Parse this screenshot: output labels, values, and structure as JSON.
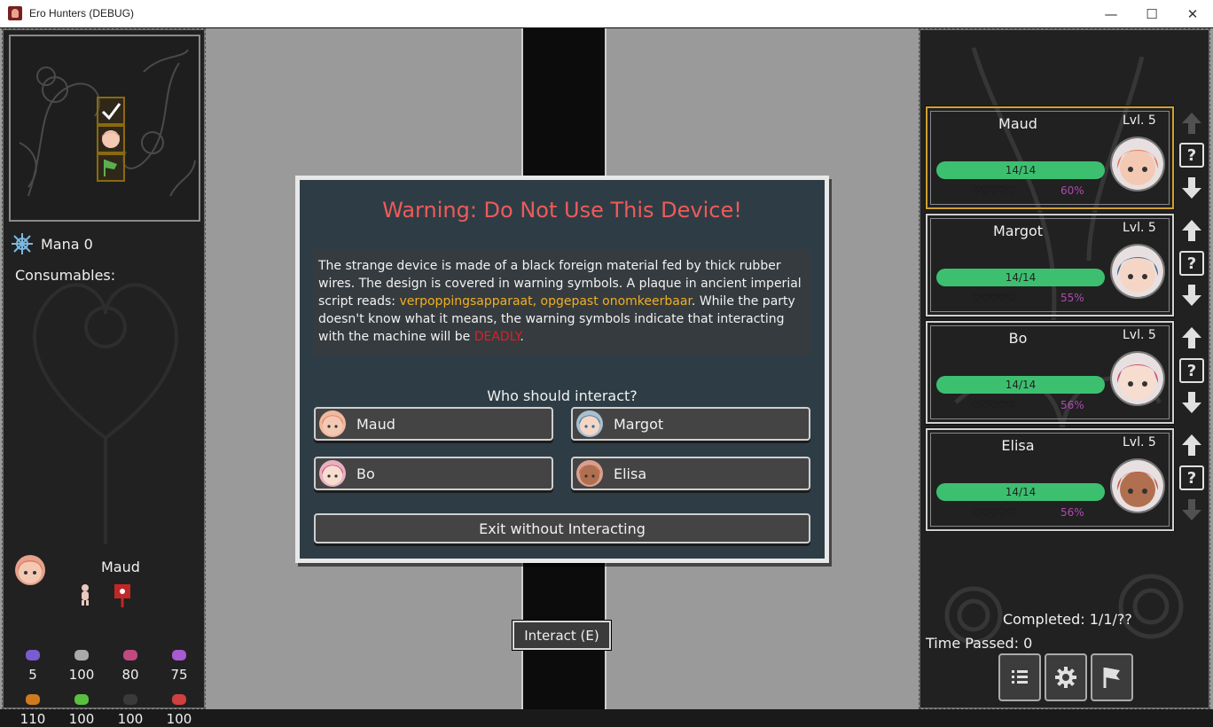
{
  "window": {
    "title": "Ero Hunters (DEBUG)",
    "minimize": "—",
    "maximize": "☐",
    "close": "✕"
  },
  "left": {
    "mana_label": "Mana 0",
    "consumables_label": "Consumables:",
    "character": {
      "name": "Maud",
      "stats": [
        {
          "icon": "level-bars-icon",
          "value": "5",
          "color": "#7a5bd0"
        },
        {
          "icon": "chain-icon",
          "value": "100",
          "color": "#aaaaaa"
        },
        {
          "icon": "pot-icon",
          "value": "80",
          "color": "#c04a80"
        },
        {
          "icon": "cloud-icon",
          "value": "75",
          "color": "#a85ad0"
        },
        {
          "icon": "strength-icon",
          "value": "110",
          "color": "#d07a20"
        },
        {
          "icon": "boot-icon",
          "value": "100",
          "color": "#5ac040"
        },
        {
          "icon": "mask-icon",
          "value": "100",
          "color": "#3a3a3a"
        },
        {
          "icon": "crab-icon",
          "value": "100",
          "color": "#d04040"
        }
      ]
    }
  },
  "modal": {
    "title": "Warning: Do Not Use This Device!",
    "body_part1": "The strange device is made of a black foreign material fed by thick rubber wires. The design is covered in warning symbols. A plaque in ancient imperial script reads: ",
    "body_highlight": "verpoppingsapparaat, opgepast onomkeerbaar",
    "body_part2": ". While the party doesn't know what it means, the warning symbols indicate that interacting with the machine will be ",
    "body_danger": "DEADLY",
    "body_part3": ".",
    "question": "Who should interact?",
    "choices": [
      "Maud",
      "Margot",
      "Bo",
      "Elisa"
    ],
    "exit_label": "Exit without Interacting"
  },
  "interact_button": "Interact (E)",
  "party": [
    {
      "name": "Maud",
      "level": "Lvl. 5",
      "hp": "14/14",
      "hearts": "♡♡♡♡♡",
      "percent": "60%",
      "hair": "#e07a60",
      "skin": "#f3c9b4"
    },
    {
      "name": "Margot",
      "level": "Lvl. 5",
      "hp": "14/14",
      "hearts": "♡♡♡♡♡",
      "percent": "55%",
      "hair": "#4a6a88",
      "skin": "#f5d6c6"
    },
    {
      "name": "Bo",
      "level": "Lvl. 5",
      "hp": "14/14",
      "hearts": "♡♡♡♡♡",
      "percent": "56%",
      "hair": "#d04a6a",
      "skin": "#f7dcd0"
    },
    {
      "name": "Elisa",
      "level": "Lvl. 5",
      "hp": "14/14",
      "hearts": "♡♡♡♡♡",
      "percent": "56%",
      "hair": "#c05a40",
      "skin": "#b07050"
    }
  ],
  "help_label": "?",
  "completed": "Completed: 1/1/??",
  "time_passed": "Time Passed: 0"
}
